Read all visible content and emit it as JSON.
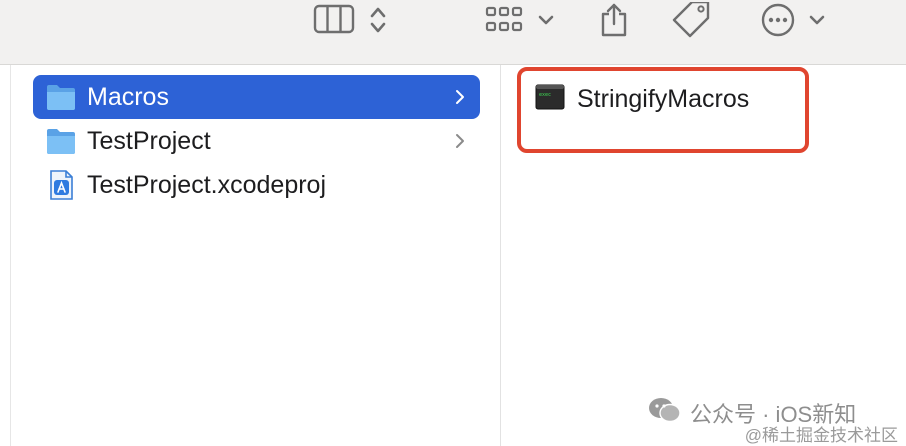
{
  "toolbar": {
    "icons": [
      "columns-view-icon",
      "sort-chevrons-icon",
      "group-grid-icon",
      "chevron-down-icon",
      "share-icon",
      "tag-icon",
      "more-icon",
      "chevron-down-icon"
    ]
  },
  "sidebar": {
    "items": [
      {
        "label": "Macros",
        "icon": "folder-icon",
        "selected": true,
        "has_chevron": true
      },
      {
        "label": "TestProject",
        "icon": "folder-icon",
        "selected": false,
        "has_chevron": true
      },
      {
        "label": "TestProject.xcodeproj",
        "icon": "xcodeproj-icon",
        "selected": false,
        "has_chevron": false
      }
    ],
    "chevron": "›"
  },
  "content": {
    "items": [
      {
        "label": "StringifyMacros",
        "icon": "terminal-executable-icon"
      }
    ]
  },
  "watermark": {
    "line1": "公众号 · iOS新知",
    "line2": "@稀土掘金技术社区"
  },
  "colors": {
    "selection": "#2d62d6",
    "highlight_border": "#e0452f",
    "folder": "#6cb4ee"
  }
}
